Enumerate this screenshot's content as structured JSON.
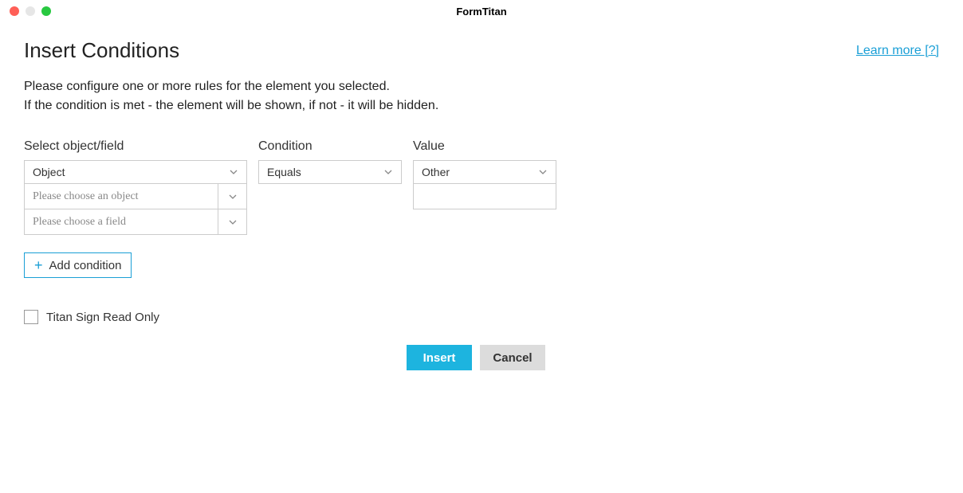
{
  "window": {
    "title": "FormTitan"
  },
  "header": {
    "title": "Insert Conditions",
    "learn_more": "Learn more [?]"
  },
  "description": {
    "line1": "Please configure one or more rules for the element you selected.",
    "line2": "If the condition is met - the element will be shown, if not - it will be hidden."
  },
  "columns": {
    "object": {
      "label": "Select object/field",
      "main_value": "Object",
      "choose_object_placeholder": "Please choose an object",
      "choose_field_placeholder": "Please choose a field"
    },
    "condition": {
      "label": "Condition",
      "value": "Equals"
    },
    "value": {
      "label": "Value",
      "selected": "Other",
      "input_value": ""
    }
  },
  "add_condition_label": "Add condition",
  "checkbox": {
    "label": "Titan Sign Read Only",
    "checked": false
  },
  "buttons": {
    "insert": "Insert",
    "cancel": "Cancel"
  }
}
